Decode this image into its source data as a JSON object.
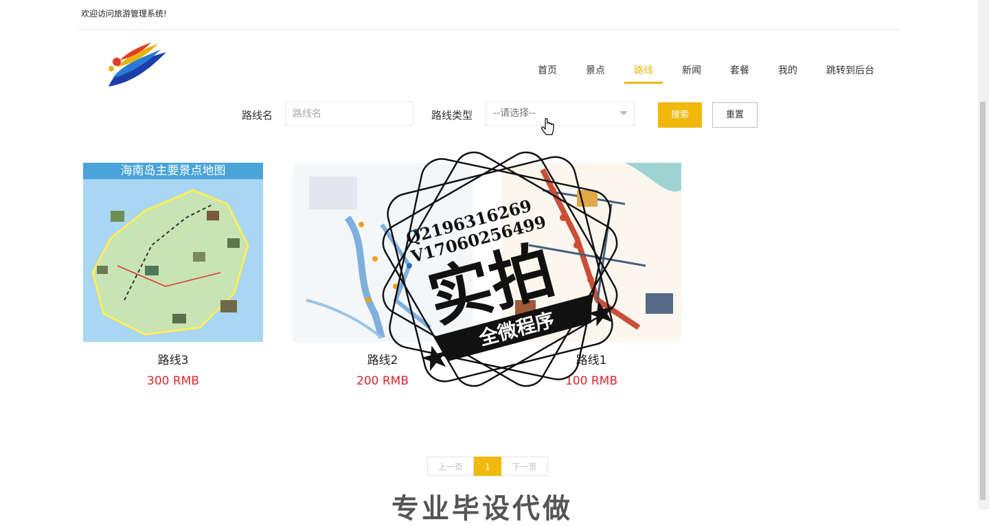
{
  "header": {
    "welcome": "欢迎访问旅游管理系统!"
  },
  "nav": {
    "items": [
      {
        "label": "首页",
        "active": false
      },
      {
        "label": "景点",
        "active": false
      },
      {
        "label": "路线",
        "active": true
      },
      {
        "label": "新闻",
        "active": false
      },
      {
        "label": "套餐",
        "active": false
      },
      {
        "label": "我的",
        "active": false
      },
      {
        "label": "跳转到后台",
        "active": false
      }
    ]
  },
  "search": {
    "name_label": "路线名",
    "name_placeholder": "路线名",
    "type_label": "路线类型",
    "type_selected": "--请选择--",
    "search_button": "搜索",
    "reset_button": "重置"
  },
  "routes": [
    {
      "name": "路线3",
      "price": "300 RMB",
      "image_title": "海南岛主要景点地图"
    },
    {
      "name": "路线2",
      "price": "200 RMB"
    },
    {
      "name": "路线1",
      "price": "100 RMB"
    }
  ],
  "pagination": {
    "prev": "上一页",
    "current": "1",
    "next": "下一页"
  },
  "overlay": {
    "line1": "Q2196316269",
    "line2": "V17060256499",
    "big": "实拍",
    "ribbon": "全微程序"
  },
  "footer": {
    "partial_text": "专业毕设代做"
  },
  "colors": {
    "accent": "#f0b90b",
    "price": "#d8272c"
  }
}
